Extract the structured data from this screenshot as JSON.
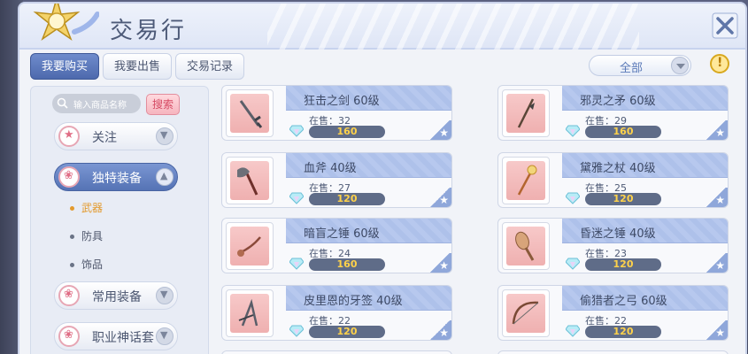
{
  "window": {
    "title": "交易行"
  },
  "tabs": [
    {
      "label": "我要购买",
      "active": true
    },
    {
      "label": "我要出售",
      "active": false
    },
    {
      "label": "交易记录",
      "active": false
    }
  ],
  "filter": {
    "selected": "全部"
  },
  "search": {
    "placeholder": "输入商品名称",
    "button": "搜索"
  },
  "sidebar": {
    "categories": [
      {
        "label": "关注",
        "icon": "star-icon",
        "active": false,
        "arrow": "▼"
      },
      {
        "label": "独特装备",
        "icon": "paw-icon",
        "active": true,
        "arrow": "▲"
      },
      {
        "label": "常用装备",
        "icon": "paw-icon",
        "active": false,
        "arrow": "▼"
      },
      {
        "label": "职业神话套",
        "icon": "paw-icon",
        "active": false,
        "arrow": "▼"
      }
    ],
    "subcategories": [
      {
        "label": "武器",
        "active": true
      },
      {
        "label": "防具",
        "active": false
      },
      {
        "label": "饰品",
        "active": false
      }
    ]
  },
  "items": [
    {
      "name": "狂击之剑 60级",
      "stock": "在售：32",
      "price": "160",
      "icon": "sword-icon"
    },
    {
      "name": "邪灵之矛 60级",
      "stock": "在售：29",
      "price": "160",
      "icon": "spear-icon"
    },
    {
      "name": "血斧 40级",
      "stock": "在售：27",
      "price": "120",
      "icon": "axe-icon"
    },
    {
      "name": "黛雅之杖 40级",
      "stock": "在售：25",
      "price": "120",
      "icon": "staff-icon"
    },
    {
      "name": "暗盲之锤 60级",
      "stock": "在售：24",
      "price": "160",
      "icon": "mace-icon"
    },
    {
      "name": "昏迷之锤 40级",
      "stock": "在售：23",
      "price": "120",
      "icon": "club-icon"
    },
    {
      "name": "皮里恩的牙签 40级",
      "stock": "在售：22",
      "price": "120",
      "icon": "dagger-icon"
    },
    {
      "name": "偷猎者之弓 60级",
      "stock": "在售：22",
      "price": "120",
      "icon": "bow-icon"
    }
  ],
  "colors": {
    "accent": "#5573b5",
    "price_text": "#ffd24a",
    "active_sub": "#e39a2d"
  }
}
